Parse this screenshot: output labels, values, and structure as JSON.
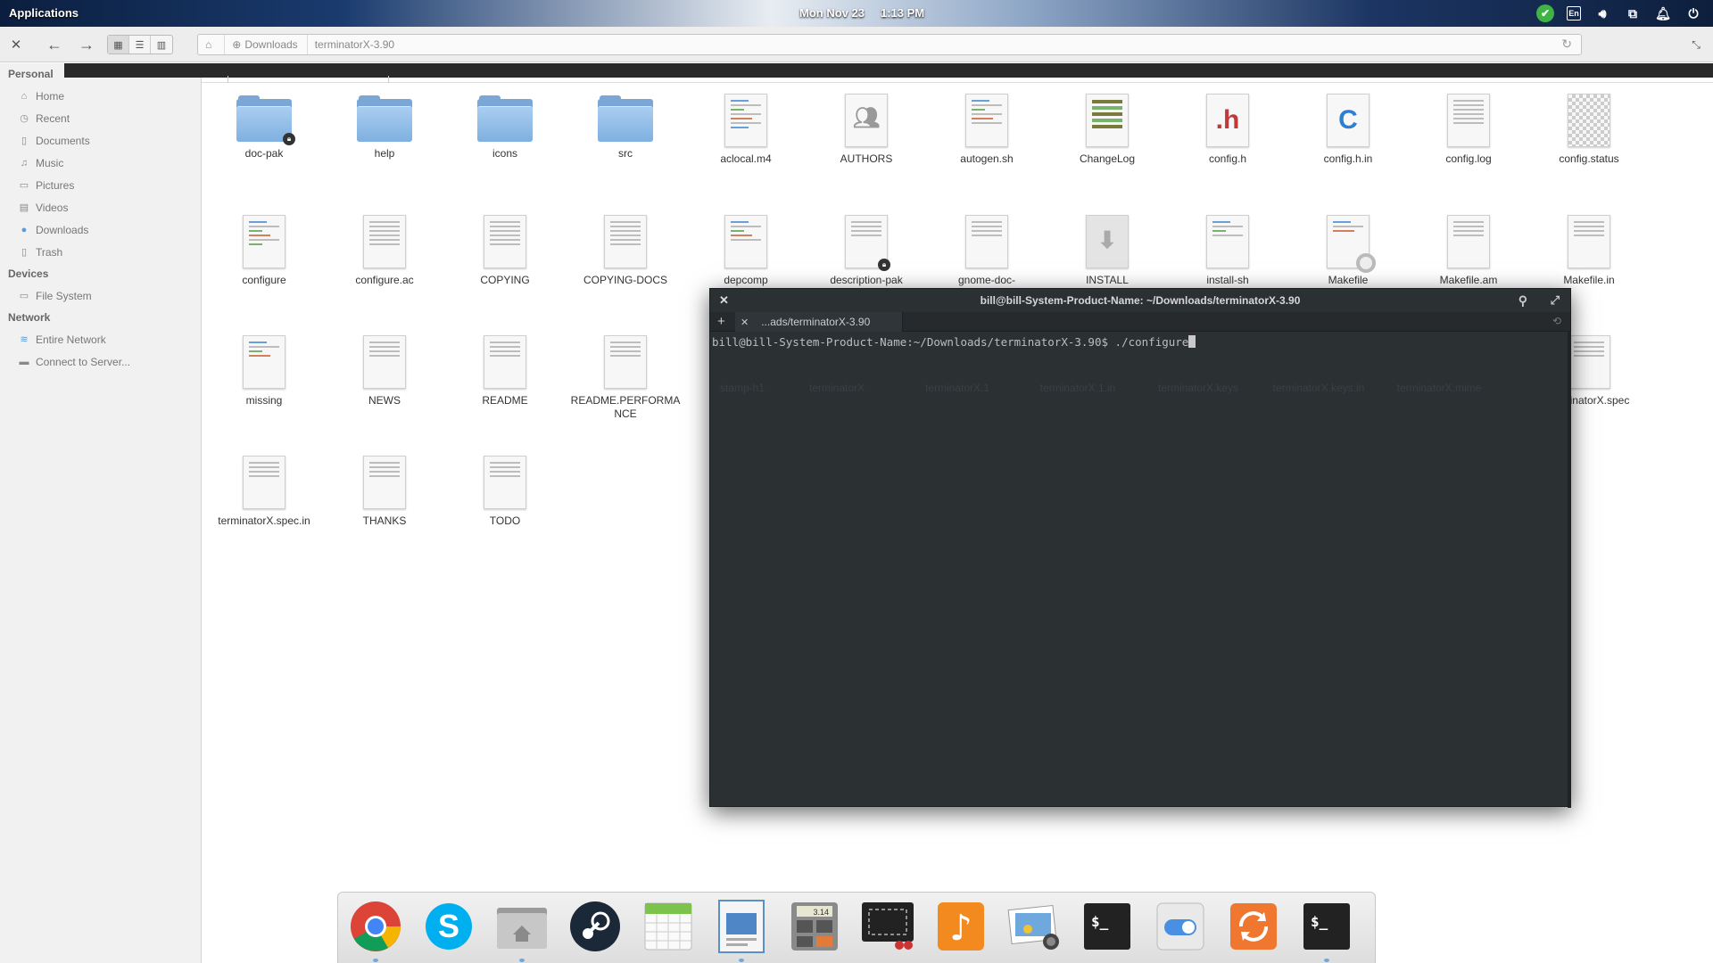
{
  "panel": {
    "applications": "Applications",
    "date": "Mon Nov 23",
    "time": "1:13 PM",
    "tray_lang": "En"
  },
  "toolbar": {
    "path": [
      "Downloads",
      "terminatorX-3.90"
    ]
  },
  "sidebar": {
    "personal": "Personal",
    "personal_items": [
      {
        "label": "Home",
        "icon": "home-icon"
      },
      {
        "label": "Recent",
        "icon": "clock-icon"
      },
      {
        "label": "Documents",
        "icon": "document-icon"
      },
      {
        "label": "Music",
        "icon": "music-icon"
      },
      {
        "label": "Pictures",
        "icon": "picture-icon"
      },
      {
        "label": "Videos",
        "icon": "video-icon"
      },
      {
        "label": "Downloads",
        "icon": "download-icon"
      },
      {
        "label": "Trash",
        "icon": "trash-icon"
      }
    ],
    "devices": "Devices",
    "device_items": [
      {
        "label": "File System",
        "icon": "drive-icon"
      }
    ],
    "network": "Network",
    "network_items": [
      {
        "label": "Entire Network",
        "icon": "wifi-icon"
      },
      {
        "label": "Connect to Server...",
        "icon": "server-icon"
      }
    ]
  },
  "files": [
    [
      "doc-pak",
      "help",
      "icons",
      "src",
      "aclocal.m4",
      "AUTHORS",
      "autogen.sh",
      "ChangeLog",
      "config.h",
      "config.h.in",
      "config.log",
      "config.status"
    ],
    [
      "configure",
      "configure.ac",
      "COPYING",
      "COPYING-DOCS",
      "depcomp",
      "description-pak",
      "gnome-doc-",
      "INSTALL",
      "install-sh",
      "Makefile",
      "Makefile.am",
      "Makefile.in"
    ],
    [
      "missing",
      "NEWS",
      "README",
      "README.PERFORMANCE",
      "terminatorX.spec"
    ],
    [
      "terminatorX.spec.in",
      "THANKS",
      "TODO"
    ]
  ],
  "terminal": {
    "title": "bill@bill-System-Product-Name: ~/Downloads/terminatorX-3.90",
    "tab_label": "...ads/terminatorX-3.90",
    "prompt": "bill@bill-System-Product-Name:~/Downloads/terminatorX-3.90$ ./configure",
    "ghost_items": [
      "stamp-h1",
      "terminatorX",
      "terminatorX.1",
      "terminatorX.1.in",
      "terminatorX.keys",
      "terminatorX.keys.in",
      "terminatorX.mime"
    ]
  },
  "dock": {
    "apps": [
      "Chrome",
      "Skype",
      "Files",
      "Steam",
      "Calendar",
      "Document Viewer",
      "Calculator",
      "Screenshot",
      "Music",
      "Photos",
      "Terminal",
      "Switchboard",
      "Update Manager",
      "Terminal"
    ],
    "calc_display": "3.14"
  }
}
